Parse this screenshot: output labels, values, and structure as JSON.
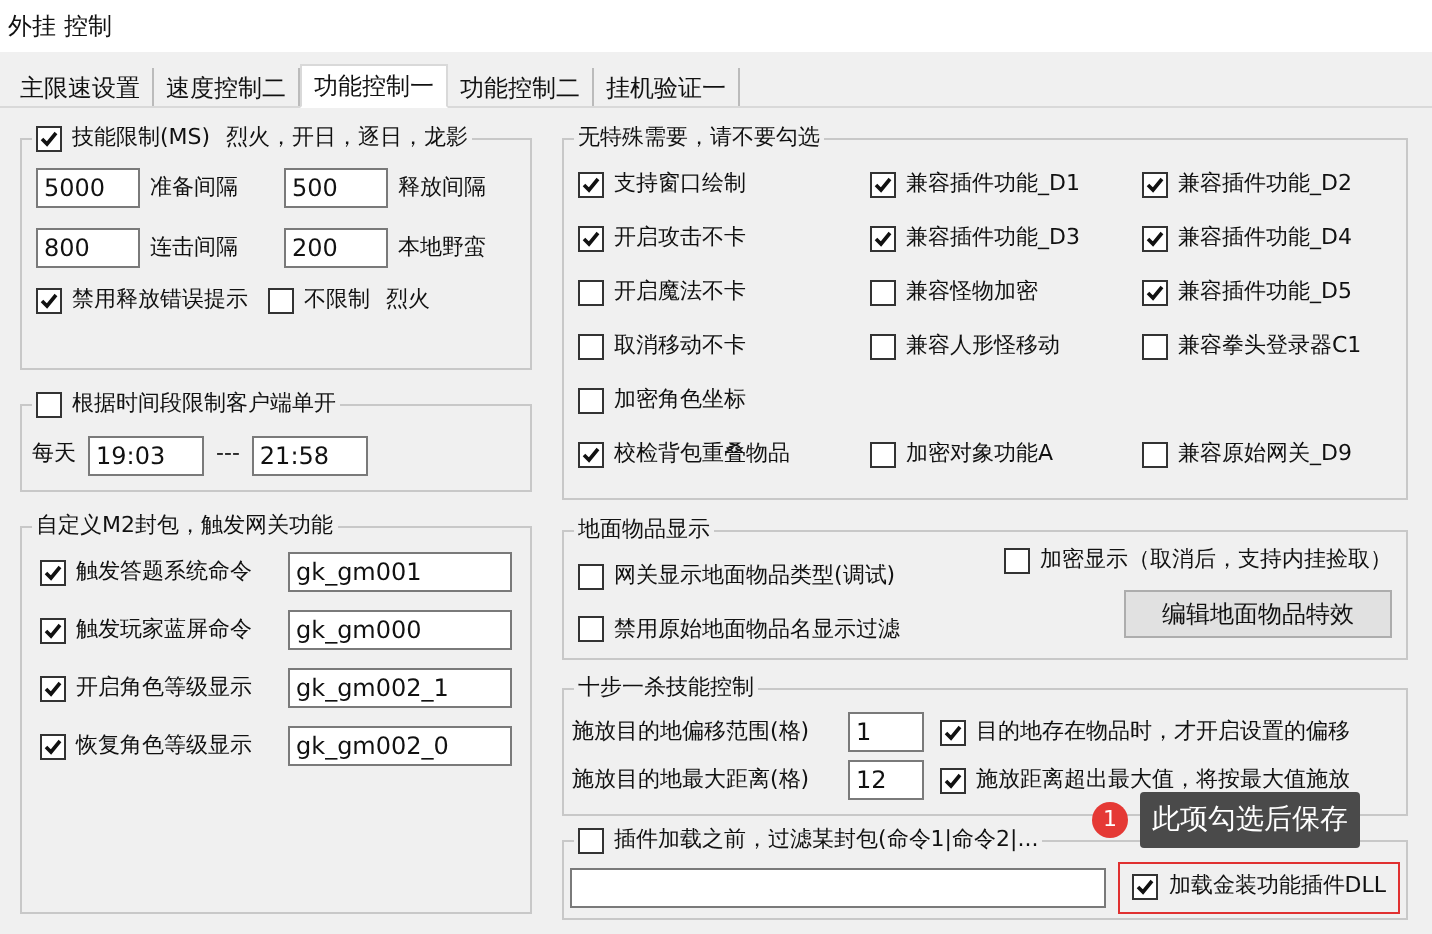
{
  "window": {
    "title": "外挂 控制"
  },
  "tabs": [
    {
      "label": "主限速设置",
      "selected": false
    },
    {
      "label": "速度控制二",
      "selected": false
    },
    {
      "label": "功能控制一",
      "selected": true
    },
    {
      "label": "功能控制二",
      "selected": false
    },
    {
      "label": "挂机验证一",
      "selected": false
    }
  ],
  "skill_limit": {
    "label": "技能限制(MS)",
    "checked": true,
    "note": "烈火，开日，逐日，龙影",
    "fields": [
      {
        "value": "5000",
        "label": "准备间隔"
      },
      {
        "value": "500",
        "label": "释放间隔"
      },
      {
        "value": "800",
        "label": "连击间隔"
      },
      {
        "value": "200",
        "label": "本地野蛮"
      }
    ],
    "options": [
      {
        "label": "禁用释放错误提示",
        "checked": true
      },
      {
        "label": "不限制",
        "checked": false,
        "note": "烈火"
      }
    ]
  },
  "time_limit": {
    "label": "根据时间段限制客户端单开",
    "checked": false,
    "day_label": "每天",
    "start": "19:03",
    "separator": "---",
    "end": "21:58"
  },
  "m2_packets": {
    "title": "自定义M2封包，触发网关功能",
    "rows": [
      {
        "label": "触发答题系统命令",
        "checked": true,
        "value": "gk_gm001"
      },
      {
        "label": "触发玩家蓝屏命令",
        "checked": true,
        "value": "gk_gm000"
      },
      {
        "label": "开启角色等级显示",
        "checked": true,
        "value": "gk_gm002_1"
      },
      {
        "label": "恢复角色等级显示",
        "checked": true,
        "value": "gk_gm002_0"
      }
    ]
  },
  "special": {
    "title": "无特殊需要，请不要勾选",
    "rows": [
      [
        {
          "label": "支持窗口绘制",
          "checked": true
        },
        {
          "label": "兼容插件功能_D1",
          "checked": true
        },
        {
          "label": "兼容插件功能_D2",
          "checked": true
        }
      ],
      [
        {
          "label": "开启攻击不卡",
          "checked": true
        },
        {
          "label": "兼容插件功能_D3",
          "checked": true
        },
        {
          "label": "兼容插件功能_D4",
          "checked": true
        }
      ],
      [
        {
          "label": "开启魔法不卡",
          "checked": false
        },
        {
          "label": "兼容怪物加密",
          "checked": false
        },
        {
          "label": "兼容插件功能_D5",
          "checked": true
        }
      ],
      [
        {
          "label": "取消移动不卡",
          "checked": false
        },
        {
          "label": "兼容人形怪移动",
          "checked": false
        },
        {
          "label": "兼容拳头登录器C1",
          "checked": false
        }
      ],
      [
        {
          "label": "加密角色坐标",
          "checked": false
        }
      ],
      [
        {
          "label": "校检背包重叠物品",
          "checked": true
        },
        {
          "label": "加密对象功能A",
          "checked": false
        },
        {
          "label": "兼容原始网关_D9",
          "checked": false
        }
      ]
    ]
  },
  "ground_items": {
    "title": "地面物品显示",
    "options": [
      {
        "label": "网关显示地面物品类型(调试)",
        "checked": false
      },
      {
        "label": "禁用原始地面物品名显示过滤",
        "checked": false
      }
    ],
    "encrypt": {
      "label": "加密显示（取消后，支持内挂捡取）",
      "checked": false
    },
    "button": "编辑地面物品特效"
  },
  "ten_step": {
    "title": "十步一杀技能控制",
    "rows": [
      {
        "label": "施放目的地偏移范围(格)",
        "value": "1",
        "option": {
          "label": "目的地存在物品时，才开启设置的偏移",
          "checked": true
        }
      },
      {
        "label": "施放目的地最大距离(格)",
        "value": "12",
        "option": {
          "label": "施放距离超出最大值，将按最大值施放",
          "checked": true
        }
      }
    ]
  },
  "plugin_filter": {
    "label": "插件加载之前，过滤某封包(命令1|命令2|...",
    "checked": false,
    "dll": {
      "label": "加载金装功能插件DLL",
      "checked": true
    }
  },
  "tooltip": {
    "badge": "1",
    "text": "此项勾选后保存"
  }
}
